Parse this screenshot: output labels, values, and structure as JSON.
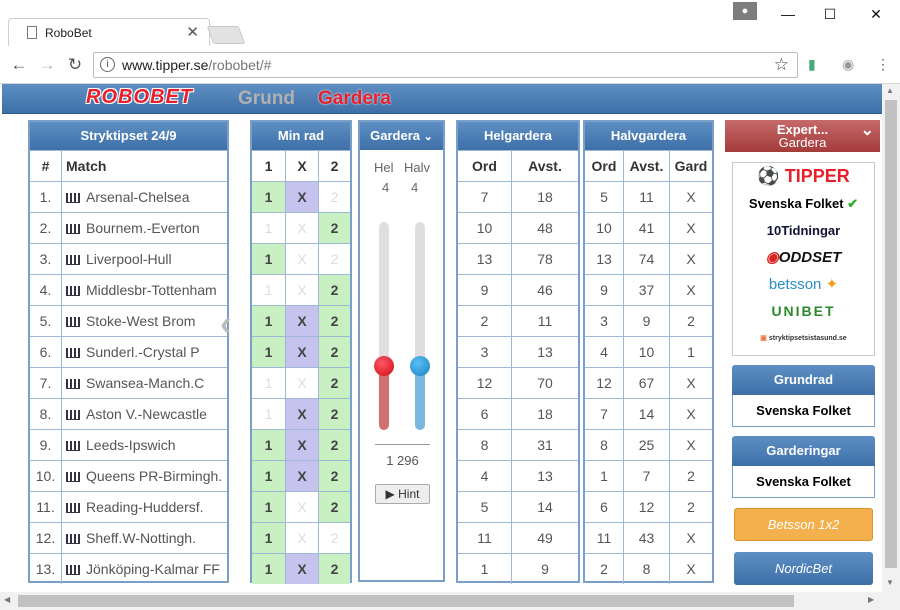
{
  "browser": {
    "tab_title": "RoboBet",
    "url_host": "www.tipper.se",
    "url_path": "/robobet/#"
  },
  "header": {
    "logo": "ROBOBET",
    "mode_grund": "Grund",
    "mode_gardera": "Gardera"
  },
  "matches": {
    "title": "Stryktipset 24/9",
    "col_num": "#",
    "col_match": "Match",
    "rows": [
      {
        "n": "1.",
        "m": "Arsenal-Chelsea"
      },
      {
        "n": "2.",
        "m": "Bournem.-Everton"
      },
      {
        "n": "3.",
        "m": "Liverpool-Hull"
      },
      {
        "n": "4.",
        "m": "Middlesbr-Tottenham"
      },
      {
        "n": "5.",
        "m": "Stoke-West Brom"
      },
      {
        "n": "6.",
        "m": "Sunderl.-Crystal P"
      },
      {
        "n": "7.",
        "m": "Swansea-Manch.C"
      },
      {
        "n": "8.",
        "m": "Aston V.-Newcastle"
      },
      {
        "n": "9.",
        "m": "Leeds-Ipswich"
      },
      {
        "n": "10.",
        "m": "Queens PR-Birmingh."
      },
      {
        "n": "11.",
        "m": "Reading-Huddersf."
      },
      {
        "n": "12.",
        "m": "Sheff.W-Nottingh."
      },
      {
        "n": "13.",
        "m": "Jönköping-Kalmar FF"
      }
    ]
  },
  "minrad": {
    "title": "Min rad",
    "cols": [
      "1",
      "X",
      "2"
    ],
    "rows": [
      [
        1,
        1,
        0
      ],
      [
        0,
        0,
        1
      ],
      [
        1,
        0,
        0
      ],
      [
        0,
        0,
        1
      ],
      [
        1,
        1,
        1
      ],
      [
        1,
        1,
        1
      ],
      [
        0,
        0,
        1
      ],
      [
        0,
        1,
        1
      ],
      [
        1,
        1,
        1
      ],
      [
        1,
        1,
        1
      ],
      [
        1,
        0,
        1
      ],
      [
        1,
        0,
        0
      ],
      [
        1,
        1,
        1
      ]
    ]
  },
  "gardera": {
    "title": "Gardera",
    "hel_label": "Hel",
    "halv_label": "Halv",
    "hel": "4",
    "halv": "4",
    "count": "1 296",
    "hint": "Hint",
    "hel_level": 0.31,
    "halv_level": 0.31
  },
  "helgardera": {
    "title": "Helgardera",
    "cols": [
      "Ord",
      "Avst."
    ],
    "rows": [
      [
        "7",
        "18"
      ],
      [
        "10",
        "48"
      ],
      [
        "13",
        "78"
      ],
      [
        "9",
        "46"
      ],
      [
        "2",
        "11"
      ],
      [
        "3",
        "13"
      ],
      [
        "12",
        "70"
      ],
      [
        "6",
        "18"
      ],
      [
        "8",
        "31"
      ],
      [
        "4",
        "13"
      ],
      [
        "5",
        "14"
      ],
      [
        "11",
        "49"
      ],
      [
        "1",
        "9"
      ]
    ]
  },
  "halvgardera": {
    "title": "Halvgardera",
    "cols": [
      "Ord",
      "Avst.",
      "Gard"
    ],
    "rows": [
      [
        "5",
        "11",
        "X"
      ],
      [
        "10",
        "41",
        "X"
      ],
      [
        "13",
        "74",
        "X"
      ],
      [
        "9",
        "37",
        "X"
      ],
      [
        "3",
        "9",
        "2"
      ],
      [
        "4",
        "10",
        "1"
      ],
      [
        "12",
        "67",
        "X"
      ],
      [
        "7",
        "14",
        "X"
      ],
      [
        "8",
        "25",
        "X"
      ],
      [
        "1",
        "7",
        "2"
      ],
      [
        "6",
        "12",
        "2"
      ],
      [
        "11",
        "43",
        "X"
      ],
      [
        "2",
        "8",
        "X"
      ]
    ]
  },
  "expert": {
    "line1": "Expert...",
    "line2": "Gardera"
  },
  "experts": [
    "TIPPER",
    "Svenska Folket",
    "10Tidningar",
    "ODDSET",
    "betsson",
    "UNIBET",
    "stryktipsetsistasund.se"
  ],
  "grundrad": {
    "title": "Grundrad",
    "value": "Svenska Folket"
  },
  "garderingar": {
    "title": "Garderingar",
    "value": "Svenska Folket"
  },
  "betsson_btn": "Betsson 1x2",
  "nordic_btn": "NordicBet",
  "colors": {
    "header_blue": "#4a7db5",
    "pick_green": "#c9f0c3",
    "pick_x": "#c6c3ef",
    "hel_red": "#d64545",
    "halv_blue": "#3a9ad9",
    "logo_red": "#e8202c"
  }
}
